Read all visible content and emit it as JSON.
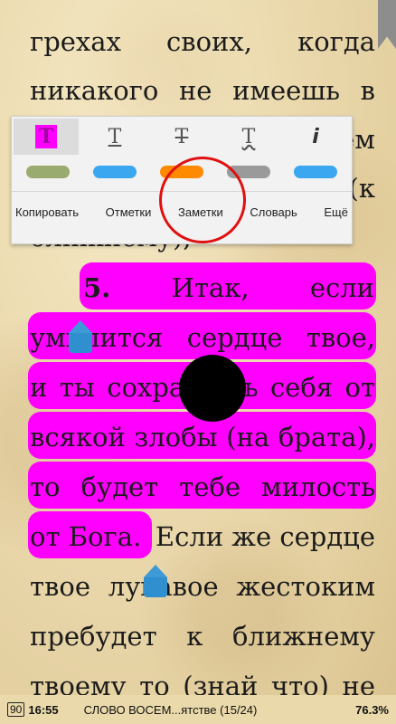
{
  "reader": {
    "lines": [
      "грехах своих, когда",
      "никакого не имеешь в",
      "",
      "",
      "",
      "",
      "",
      "умилится сердце твое,",
      "и ты сохранишь себя от",
      "всякой злобы (на брата),",
      "то будет тебе милость",
      "от Бога.",
      "твое лукавое жестоким",
      "пребудет к ближнему",
      "твоему то (знай что) не"
    ],
    "partial_line_3_tail": "ем",
    "partial_line_4_tail": "(к",
    "partial_line_5": "ближнему),",
    "para_num": "5.",
    "para_words": [
      "Итак,",
      "если"
    ],
    "line11_tail": "Если же сердце"
  },
  "toolbar": {
    "icons": [
      {
        "name": "highlight-tool-icon",
        "glyph": "T",
        "style": "highlight"
      },
      {
        "name": "underline-tool-icon",
        "glyph": "T",
        "style": "underline"
      },
      {
        "name": "strikethrough-tool-icon",
        "glyph": "T",
        "style": "strike"
      },
      {
        "name": "wavy-underline-tool-icon",
        "glyph": "T",
        "style": "wavy"
      },
      {
        "name": "info-icon",
        "glyph": "i",
        "style": "info"
      }
    ],
    "colors": [
      "#9aab70",
      "#3aa7f0",
      "#ff8a00",
      "#9a9a9a",
      "#3aa7f0"
    ],
    "menu": [
      "Копировать",
      "Отметки",
      "Заметки",
      "Словарь",
      "Ещё"
    ]
  },
  "status_bar": {
    "battery": "90",
    "time": "16:55",
    "book_title": "СЛОВО ВОСЕМ...ятстве (15/24)",
    "progress": "76.3%"
  },
  "colors": {
    "highlight": "#ff00ff",
    "handle": "#2f8fcf",
    "annotation_circle": "#e01010"
  }
}
